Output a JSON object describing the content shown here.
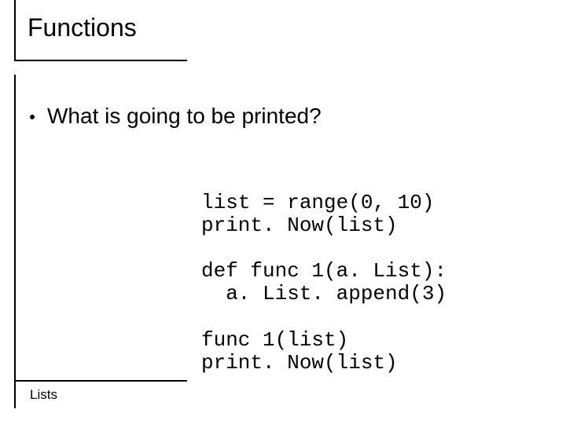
{
  "title": "Functions",
  "bullet": "What is going to be printed?",
  "code": "list = range(0, 10)\nprint. Now(list)\n\ndef func 1(a. List):\n  a. List. append(3)\n\nfunc 1(list)\nprint. Now(list)",
  "footer": "Lists"
}
